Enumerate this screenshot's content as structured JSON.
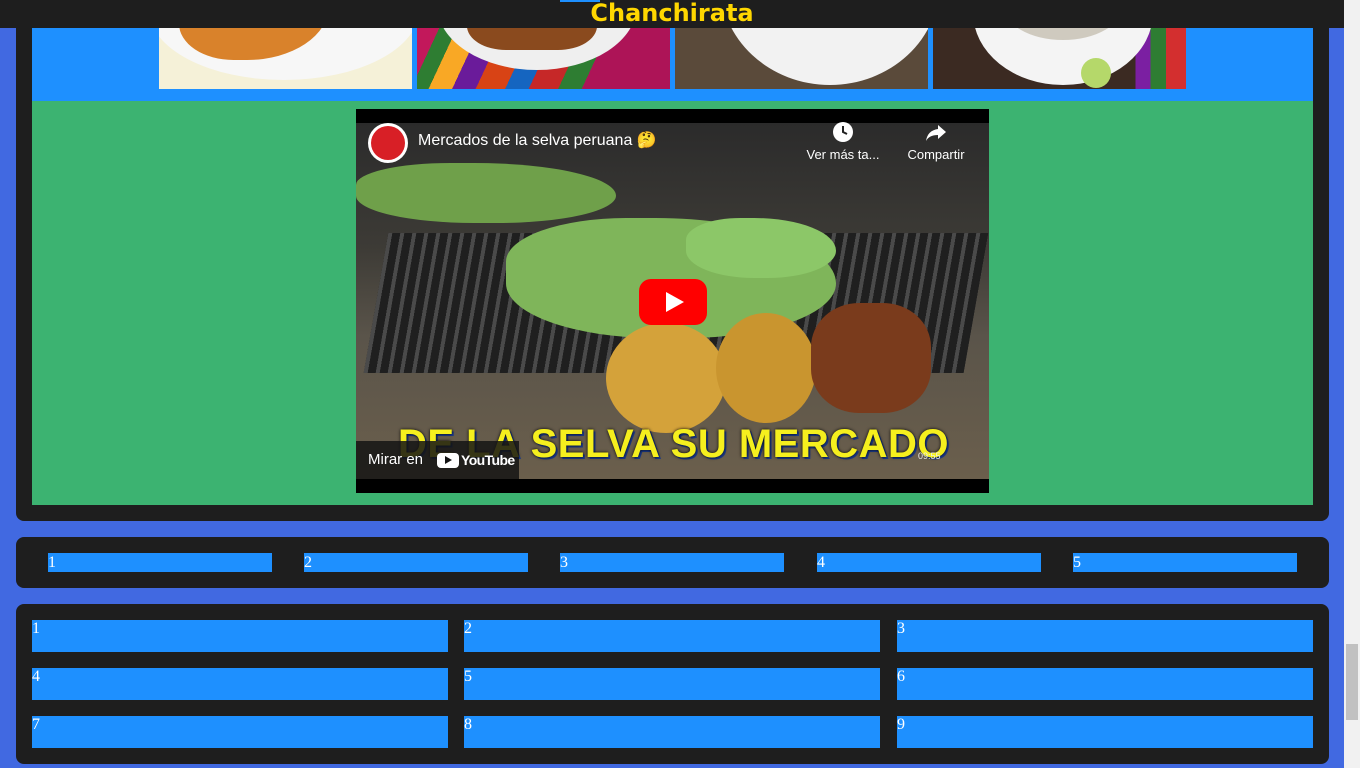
{
  "header": {
    "site_title": "Chanchirata"
  },
  "gallery": {
    "items": [
      {
        "name": "dish-photo-1"
      },
      {
        "name": "dish-photo-2"
      },
      {
        "name": "dish-photo-3"
      },
      {
        "name": "dish-photo-4"
      }
    ]
  },
  "video": {
    "title": "Mercados de la selva peruana 🤔",
    "watch_later_label": "Ver más ta...",
    "share_label": "Compartir",
    "watch_on_label": "Mirar en",
    "youtube_wordmark": "YouTube",
    "overlay_caption": "DE LA SELVA SU MERCADO",
    "timestamp": "09:55",
    "icons": {
      "watch_later": "clock-icon",
      "share": "share-arrow-icon",
      "play": "play-icon"
    }
  },
  "pager": {
    "links": [
      "1",
      "2",
      "3",
      "4",
      "5"
    ]
  },
  "grid": {
    "cells": [
      "1",
      "2",
      "3",
      "4",
      "5",
      "6",
      "7",
      "8",
      "9"
    ]
  },
  "colors": {
    "page_bg": "#4169e1",
    "panel_bg": "#1e1e1e",
    "accent_blue": "#1e90ff",
    "video_section_bg": "#3cb371",
    "title_gold": "#ffd700"
  }
}
